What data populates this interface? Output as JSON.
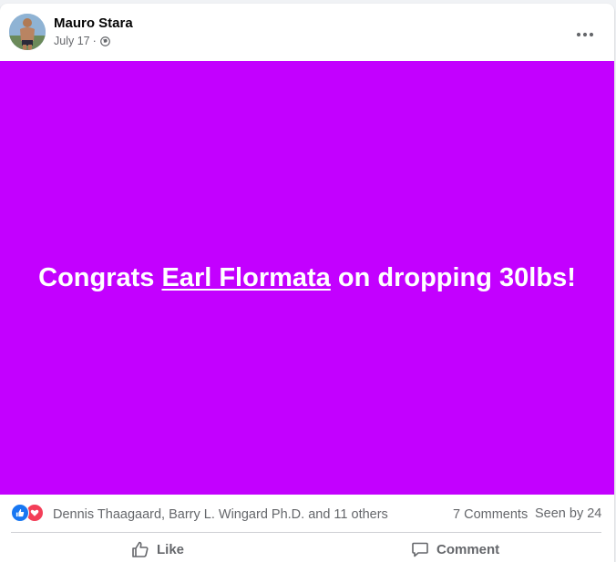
{
  "post": {
    "author": "Mauro Stara",
    "date": "July 17",
    "separator": "·",
    "audience_icon": "globe-icon",
    "more_icon": "more-options-icon",
    "banner": {
      "background": "#c300ff",
      "text_before": "Congrats ",
      "mention": "Earl Flormata",
      "text_after": " on dropping 30lbs!"
    }
  },
  "reactions": {
    "icons": [
      "like-reaction-icon",
      "love-reaction-icon"
    ],
    "names": "Dennis Thaagaard, Barry L. Wingard Ph.D. and 11 others",
    "comments": "7 Comments",
    "seen_by": "Seen by 24"
  },
  "actions": {
    "like_label": "Like",
    "comment_label": "Comment"
  },
  "colors": {
    "accent_blue": "#1877f2",
    "love_red": "#f33e58",
    "secondary_text": "#65676b"
  }
}
